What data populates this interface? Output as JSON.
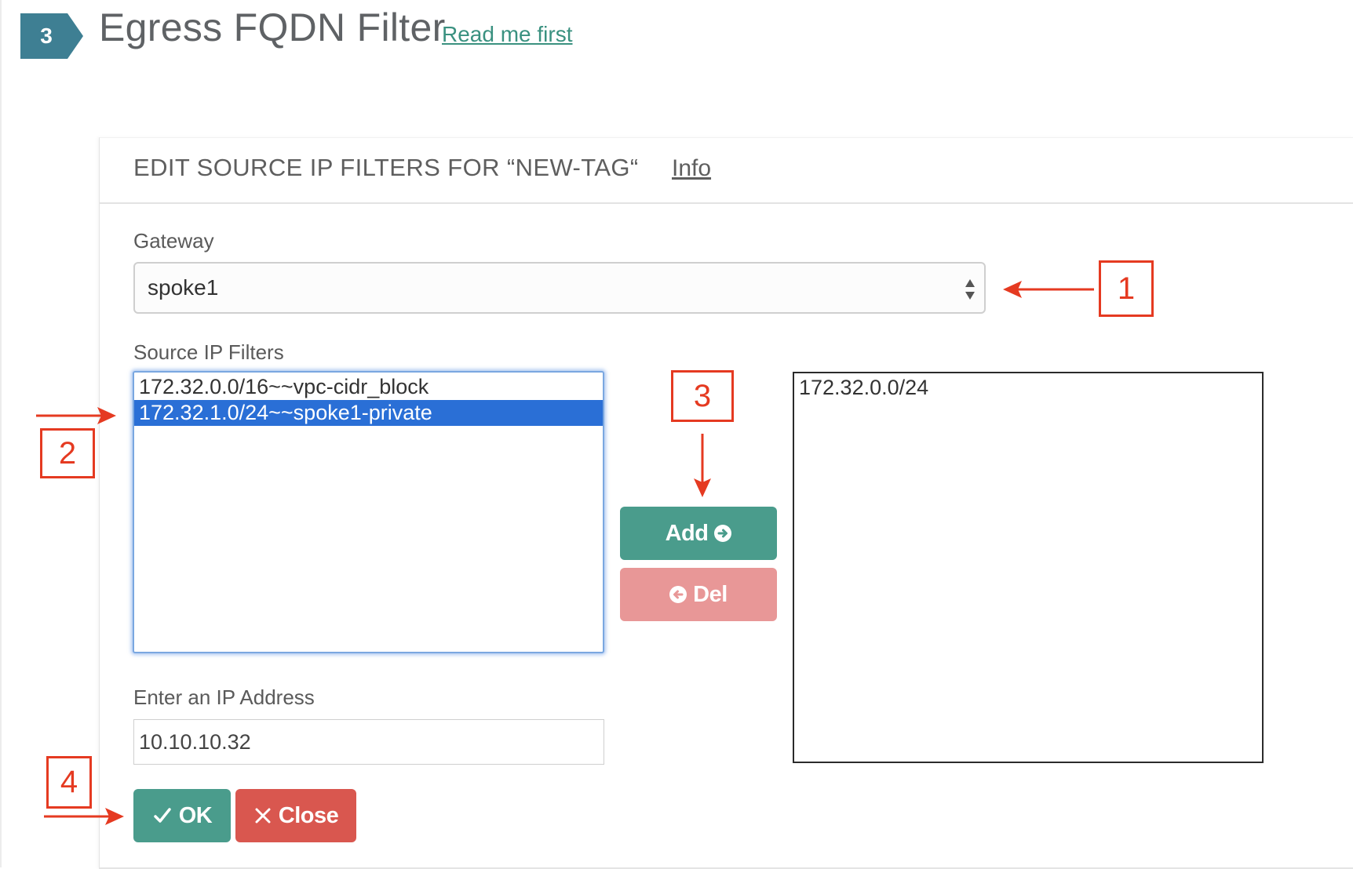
{
  "header": {
    "step_number": "3",
    "title": "Egress FQDN Filter",
    "readme_link": "Read me first"
  },
  "panel": {
    "title": "EDIT SOURCE IP FILTERS FOR “NEW-TAG“",
    "info_link": "Info",
    "gateway": {
      "label": "Gateway",
      "selected": "spoke1"
    },
    "source_filters": {
      "label": "Source IP Filters",
      "available": [
        "172.32.0.0/16~~vpc-cidr_block",
        "172.32.1.0/24~~spoke1-private"
      ],
      "selected_index": 1,
      "chosen": [
        "172.32.0.0/24"
      ]
    },
    "add_button": "Add",
    "del_button": "Del",
    "ip_input": {
      "label": "Enter an IP Address",
      "value": "10.10.10.32"
    },
    "ok_button": "OK",
    "close_button": "Close"
  },
  "annotations": [
    "1",
    "2",
    "3",
    "4"
  ],
  "colors": {
    "accent": "#4a9c8c",
    "danger": "#d9574f",
    "danger_light": "#e89797",
    "selection": "#2a6fd6",
    "annotation": "#e53a21",
    "badge": "#3e7f93"
  },
  "icons": {
    "add": "arrow-circle-right-icon",
    "del": "arrow-circle-left-icon",
    "ok": "check-icon",
    "close": "x-icon",
    "select": "sort-arrows-icon"
  }
}
